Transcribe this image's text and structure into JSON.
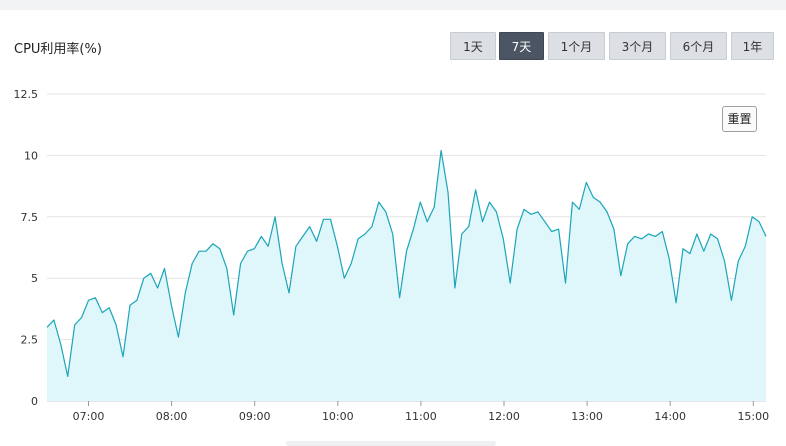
{
  "title": "CPU利用率(%)",
  "range_buttons": [
    {
      "label": "1天",
      "active": false
    },
    {
      "label": "7天",
      "active": true
    },
    {
      "label": "1个月",
      "active": false
    },
    {
      "label": "3个月",
      "active": false
    },
    {
      "label": "6个月",
      "active": false
    },
    {
      "label": "1年",
      "active": false
    }
  ],
  "reset_label": "重置",
  "colors": {
    "line": "#1aa5b8",
    "fill": "#dff6fb",
    "grid": "#e3e3e3",
    "active_button": "#4b5563"
  },
  "chart_data": {
    "type": "area",
    "ylim": [
      0,
      12.5
    ],
    "yticks": [
      0,
      2.5,
      5,
      7.5,
      10,
      12.5
    ],
    "ytick_labels": [
      "0",
      "2.5",
      "5",
      "7.5",
      "10",
      "12.5"
    ],
    "xticks": [
      "07:00",
      "08:00",
      "09:00",
      "10:00",
      "11:00",
      "12:00",
      "13:00",
      "14:00",
      "15:00"
    ],
    "grid": true,
    "series": [
      {
        "values": [
          3.0,
          3.3,
          2.3,
          1.0,
          3.1,
          3.4,
          4.1,
          4.2,
          3.6,
          3.8,
          3.1,
          1.8,
          3.9,
          4.1,
          5.0,
          5.2,
          4.6,
          5.4,
          3.9,
          2.6,
          4.4,
          5.6,
          6.1,
          6.1,
          6.4,
          6.2,
          5.4,
          3.5,
          5.6,
          6.1,
          6.2,
          6.7,
          6.3,
          7.5,
          5.6,
          4.4,
          6.3,
          6.7,
          7.1,
          6.5,
          7.4,
          7.4,
          6.3,
          5.0,
          5.6,
          6.6,
          6.8,
          7.1,
          8.1,
          7.7,
          6.8,
          4.2,
          6.1,
          7.0,
          8.1,
          7.3,
          7.9,
          10.2,
          8.5,
          4.6,
          6.8,
          7.1,
          8.6,
          7.3,
          8.1,
          7.7,
          6.6,
          4.8,
          7.0,
          7.8,
          7.6,
          7.7,
          7.3,
          6.9,
          7.0,
          4.8,
          8.1,
          7.8,
          8.9,
          8.3,
          8.1,
          7.7,
          7.0,
          5.1,
          6.4,
          6.7,
          6.6,
          6.8,
          6.7,
          6.9,
          5.8,
          4.0,
          6.2,
          6.0,
          6.8,
          6.1,
          6.8,
          6.6,
          5.7,
          4.1,
          5.7,
          6.3,
          7.5,
          7.3,
          6.7
        ]
      }
    ]
  }
}
